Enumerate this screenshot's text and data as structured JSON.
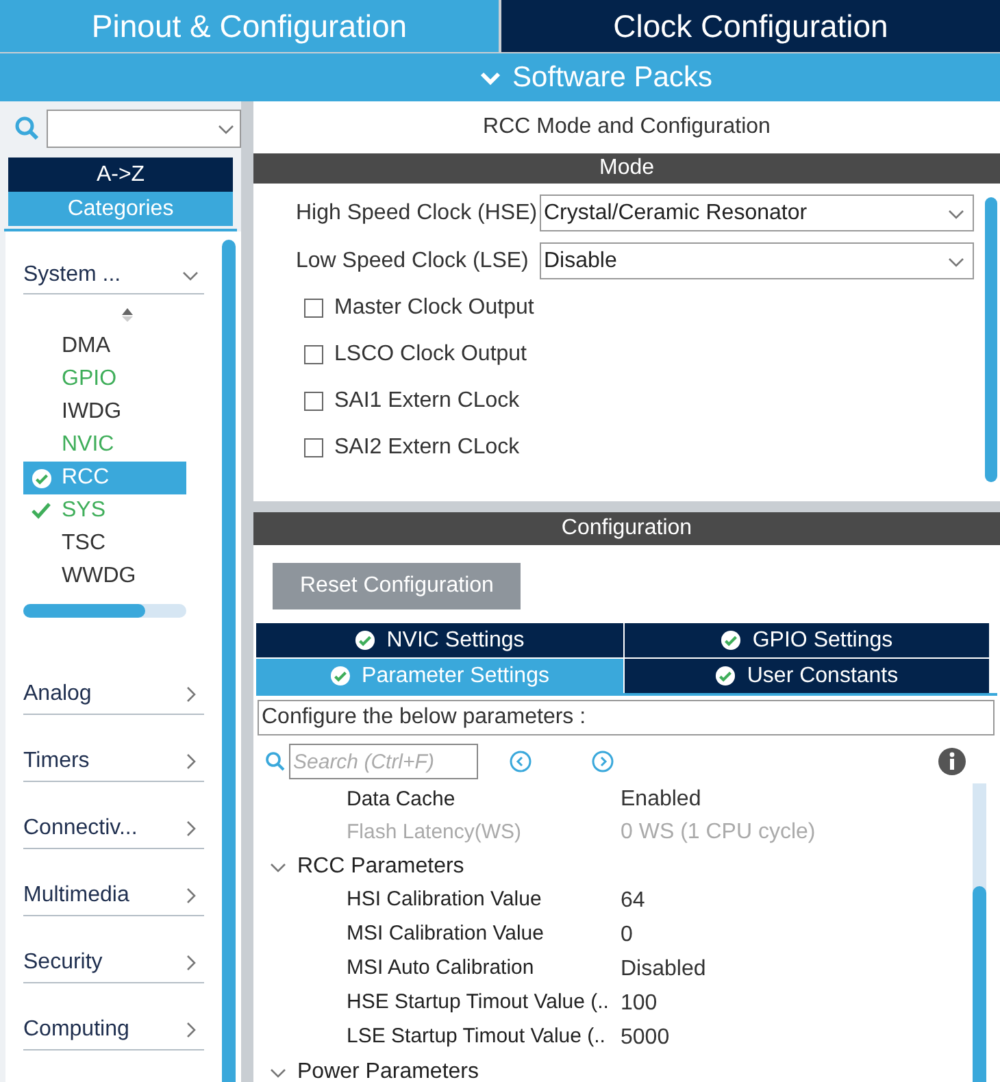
{
  "top_tabs": [
    {
      "label": "Pinout & Configuration",
      "selected": true
    },
    {
      "label": "Clock Configuration",
      "selected": false
    }
  ],
  "software_packs": {
    "label": "Software Packs"
  },
  "sidebar": {
    "sort_tabs": [
      {
        "label": "A->Z",
        "selected": false
      },
      {
        "label": "Categories",
        "selected": true
      }
    ],
    "group": {
      "label": "System ...",
      "expanded": true,
      "items": [
        {
          "label": "DMA",
          "configured": false,
          "enabled": false,
          "selected": false
        },
        {
          "label": "GPIO",
          "configured": false,
          "enabled": true,
          "selected": false
        },
        {
          "label": "IWDG",
          "configured": false,
          "enabled": false,
          "selected": false
        },
        {
          "label": "NVIC",
          "configured": false,
          "enabled": true,
          "selected": false
        },
        {
          "label": "RCC",
          "configured": true,
          "enabled": true,
          "selected": true
        },
        {
          "label": "SYS",
          "configured": true,
          "enabled": true,
          "selected": false
        },
        {
          "label": "TSC",
          "configured": false,
          "enabled": false,
          "selected": false
        },
        {
          "label": "WWDG",
          "configured": false,
          "enabled": false,
          "selected": false
        }
      ]
    },
    "categories": [
      {
        "label": "Analog",
        "expanded": false
      },
      {
        "label": "Timers",
        "expanded": false
      },
      {
        "label": "Connectiv...",
        "expanded": false
      },
      {
        "label": "Multimedia",
        "expanded": false
      },
      {
        "label": "Security",
        "expanded": false
      },
      {
        "label": "Computing",
        "expanded": false
      }
    ]
  },
  "mode_panel": {
    "title": "RCC Mode and Configuration",
    "header": "Mode",
    "selects": [
      {
        "label": "High Speed Clock (HSE)",
        "value": "Crystal/Ceramic Resonator"
      },
      {
        "label": "Low Speed Clock (LSE)",
        "value": "Disable"
      }
    ],
    "checkboxes": [
      {
        "label": "Master Clock Output",
        "checked": false
      },
      {
        "label": "LSCO Clock Output",
        "checked": false
      },
      {
        "label": "SAI1 Extern CLock",
        "checked": false
      },
      {
        "label": "SAI2 Extern CLock",
        "checked": false
      }
    ]
  },
  "configuration": {
    "header": "Configuration",
    "reset_button": "Reset Configuration",
    "tabs": [
      {
        "label": "NVIC Settings",
        "selected": false
      },
      {
        "label": "GPIO Settings",
        "selected": false
      },
      {
        "label": "Parameter Settings",
        "selected": true
      },
      {
        "label": "User Constants",
        "selected": false
      }
    ],
    "hint": "Configure the below parameters :",
    "search": {
      "placeholder": "Search (Ctrl+F)"
    },
    "tree": [
      {
        "label": "Data Cache",
        "value": "Enabled",
        "disabled": false
      },
      {
        "label": "Flash Latency(WS)",
        "value": "0 WS (1 CPU cycle)",
        "disabled": true
      },
      {
        "label": "RCC Parameters",
        "kind": "group",
        "expanded": true,
        "children": [
          {
            "label": "HSI Calibration Value",
            "value": "64",
            "disabled": false
          },
          {
            "label": "MSI Calibration Value",
            "value": "0",
            "disabled": false
          },
          {
            "label": "MSI Auto Calibration",
            "value": "Disabled",
            "disabled": false
          },
          {
            "label": "HSE Startup Timout Value (..",
            "value": "100",
            "disabled": false
          },
          {
            "label": "LSE Startup Timout Value (..",
            "value": "5000",
            "disabled": false
          }
        ]
      },
      {
        "label": "Power Parameters",
        "kind": "group",
        "expanded": true
      }
    ]
  }
}
